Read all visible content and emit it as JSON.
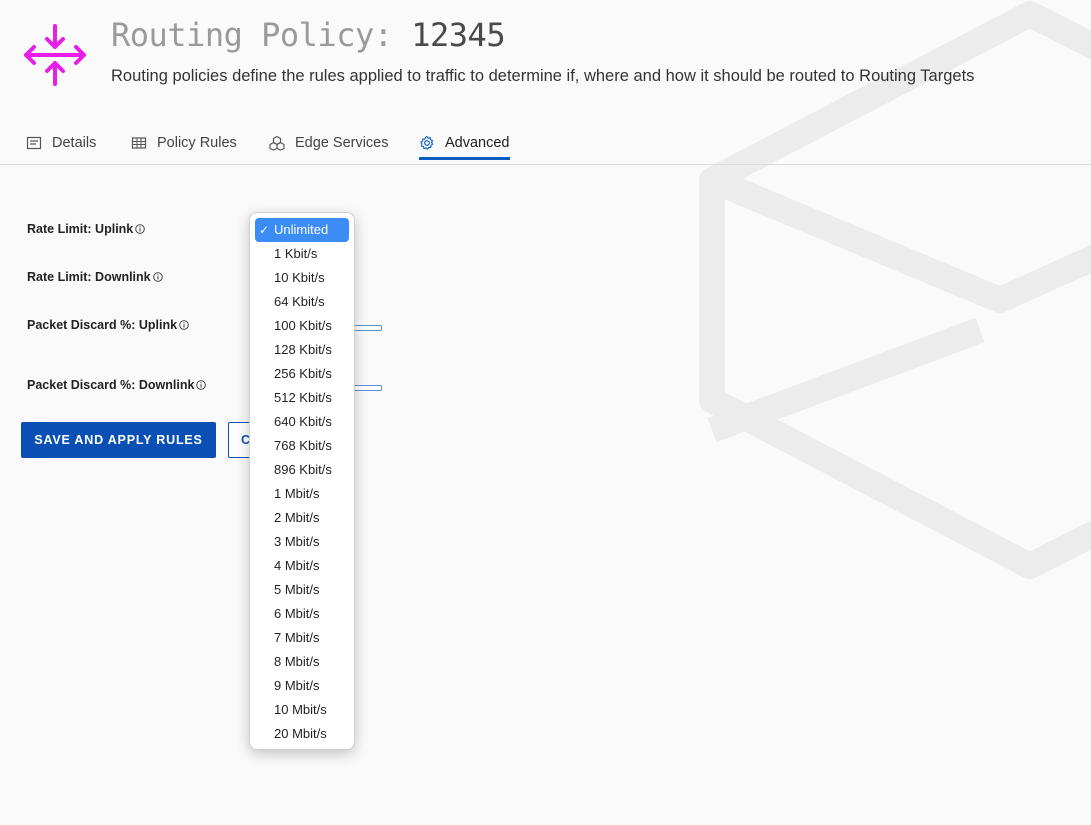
{
  "header": {
    "icon": "routing-arrows-icon",
    "icon_color": "#e81ee8",
    "title_prefix": "Routing Policy: ",
    "title_id": "12345",
    "subtitle": "Routing policies define the rules applied to traffic to determine if, where and how it should be routed to Routing Targets"
  },
  "tabs": [
    {
      "label": "Details",
      "icon": "document-icon"
    },
    {
      "label": "Policy Rules",
      "icon": "table-icon"
    },
    {
      "label": "Edge Services",
      "icon": "cubes-icon"
    },
    {
      "label": "Advanced",
      "icon": "gear-icon",
      "active": true
    }
  ],
  "form": {
    "rate_limit_uplink_label": "Rate Limit: Uplink",
    "rate_limit_downlink_label": "Rate Limit: Downlink",
    "packet_discard_uplink_label": "Packet Discard %: Uplink",
    "packet_discard_downlink_label": "Packet Discard %: Downlink"
  },
  "actions": {
    "save_label": "SAVE AND APPLY RULES",
    "cancel_label": "C"
  },
  "dropdown": {
    "selected": "Unlimited",
    "options": [
      "Unlimited",
      "1 Kbit/s",
      "10 Kbit/s",
      "64 Kbit/s",
      "100 Kbit/s",
      "128 Kbit/s",
      "256 Kbit/s",
      "512 Kbit/s",
      "640 Kbit/s",
      "768 Kbit/s",
      "896 Kbit/s",
      "1 Mbit/s",
      "2 Mbit/s",
      "3 Mbit/s",
      "4 Mbit/s",
      "5 Mbit/s",
      "6 Mbit/s",
      "7 Mbit/s",
      "8 Mbit/s",
      "9 Mbit/s",
      "10 Mbit/s",
      "20 Mbit/s"
    ]
  },
  "colors": {
    "accent": "#0a50b4",
    "tab_underline": "#0a5cc2",
    "selected_option": "#3b8cf5"
  }
}
